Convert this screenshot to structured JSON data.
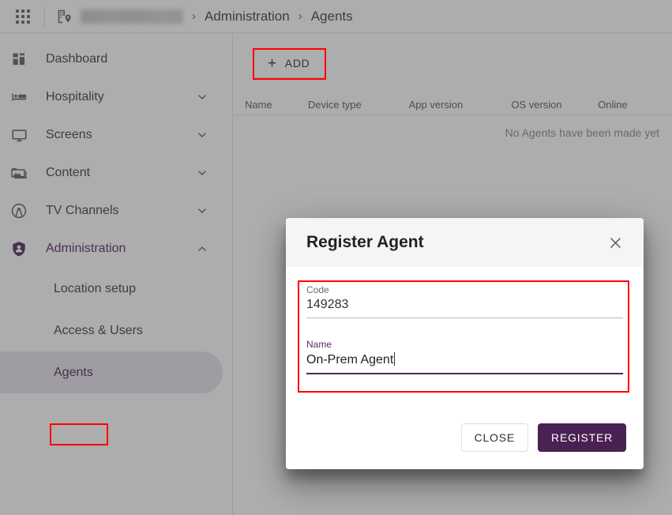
{
  "topbar": {
    "apps_icon": "apps-grid-icon",
    "location_icon": "building-location-icon",
    "tenant_name_redacted": "",
    "separator": "›",
    "breadcrumb": [
      {
        "label": "Administration"
      },
      {
        "label": "Agents"
      }
    ]
  },
  "sidebar": {
    "items": [
      {
        "label": "Dashboard",
        "icon": "dashboard-icon",
        "expandable": false,
        "expanded": false
      },
      {
        "label": "Hospitality",
        "icon": "bed-icon",
        "expandable": true,
        "expanded": false
      },
      {
        "label": "Screens",
        "icon": "monitor-icon",
        "expandable": true,
        "expanded": false
      },
      {
        "label": "Content",
        "icon": "image-folder-icon",
        "expandable": true,
        "expanded": false
      },
      {
        "label": "TV Channels",
        "icon": "broadcast-icon",
        "expandable": true,
        "expanded": false
      },
      {
        "label": "Administration",
        "icon": "shield-person-icon",
        "expandable": true,
        "expanded": true
      }
    ],
    "subitems": [
      {
        "label": "Location setup",
        "active": false
      },
      {
        "label": "Access & Users",
        "active": false
      },
      {
        "label": "Agents",
        "active": true
      }
    ]
  },
  "main": {
    "add_button": {
      "label": "ADD",
      "plus": "+"
    },
    "table": {
      "columns": [
        "Name",
        "Device type",
        "App version",
        "OS version",
        "Online"
      ],
      "rows": [],
      "empty_message": "No Agents have been made yet"
    }
  },
  "dialog": {
    "title": "Register Agent",
    "close_icon": "close-icon",
    "fields": [
      {
        "label": "Code",
        "value": "149283",
        "focused": false
      },
      {
        "label": "Name",
        "value": "On-Prem Agent",
        "focused": true
      }
    ],
    "buttons": {
      "close": "CLOSE",
      "register": "REGISTER"
    }
  },
  "annotations": {
    "color": "#ff0000",
    "boxes": [
      "add-button",
      "sidebar-agents",
      "dialog-fields"
    ]
  },
  "colors": {
    "accent_purple": "#4a2153",
    "annotation_red": "#ff0000",
    "backdrop": "rgba(60,60,60,0.42)",
    "active_nav_bg": "#e8e4ed"
  }
}
